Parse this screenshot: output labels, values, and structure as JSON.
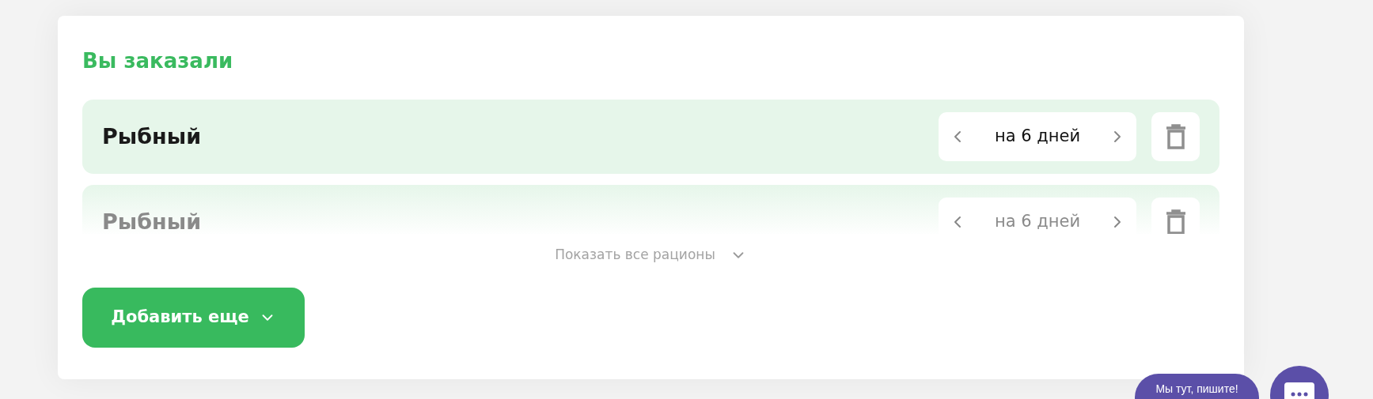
{
  "order": {
    "title": "Вы заказали",
    "items": [
      {
        "name": "Рыбный",
        "duration": "на 6 дней",
        "faded": false
      },
      {
        "name": "Рыбный",
        "duration": "на 6 дней",
        "faded": true
      }
    ],
    "show_all": "Показать все рационы",
    "add_button": "Добавить еще"
  },
  "chat": {
    "label": "Мы тут, пишите!"
  }
}
